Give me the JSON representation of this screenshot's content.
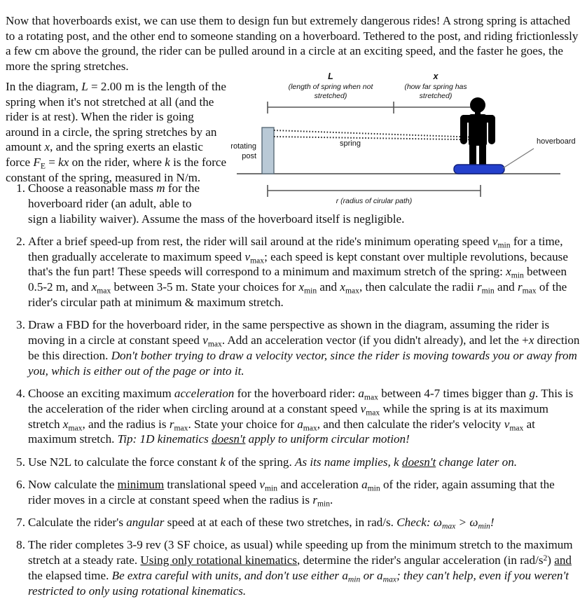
{
  "document": {
    "intro_paragraph": "Now that hoverboards exist, we can use them to design fun but extremely dangerous rides! A strong spring is attached to a rotating post, and the other end to someone standing on a hoverboard. Tethered to the post, and riding frictionlessly a few cm above the ground, the rider can be pulled around in a circle at an exciting speed, and the faster he goes, the more the spring stretches.",
    "setup_paragraph": {
      "segments": [
        "In the diagram, ",
        "L",
        " = 2.00 m is the length of the spring when it's not stretched at all (and the rider is at rest). When the rider is going around in a circle, the spring stretches by an amount ",
        "x",
        ", and the spring exerts an elastic force ",
        "F",
        "E",
        " = ",
        "kx",
        " on the rider, where ",
        "k",
        " is the force constant of the spring, measured in N/m."
      ],
      "spring_rest_length": "2.00 m",
      "spring_length_symbol": "L",
      "stretch_symbol": "x",
      "force_law": "F_E = kx",
      "force_constant_symbol": "k",
      "force_constant_units": "N/m"
    }
  },
  "figure": {
    "caption_L_symbol": "L",
    "caption_L_desc_line1": "(length of spring when not",
    "caption_L_desc_line2": "stretched)",
    "caption_x_symbol": "x",
    "caption_x_desc_line1": "(how far spring has",
    "caption_x_desc_line2": "stretched)",
    "label_rotating_post_line1": "rotating",
    "label_rotating_post_line2": "post",
    "label_spring": "spring",
    "label_hoverboard": "hoverboard",
    "label_radius": "r (radius of cirular path)",
    "colors": {
      "post_fill": "#b9c9d6",
      "post_stroke": "#5a6b78",
      "hoverboard_fill": "#2440cc",
      "hoverboard_stroke": "#101f7a",
      "rider_fill": "#000000",
      "dimension_line": "#555555",
      "ground_line": "#444444",
      "leader_line": "#777777",
      "spring_dots": "#222222"
    }
  },
  "questions": [
    {
      "number": "1.",
      "html": "Choose a reasonable mass <i>m</i> for the<br>hoverboard rider (an adult, able to<br>sign a liability waiver). Assume the mass of the hoverboard itself is negligible."
    },
    {
      "number": "2.",
      "html": "After a brief speed-up from rest, the rider will sail around at the ride's minimum operating speed <i>v</i><sub>min</sub> for a time, then gradually accelerate to maximum speed <i>v</i><sub>max</sub>; each speed is kept constant over multiple revolutions, because that's the fun part! These speeds will correspond to a minimum and maximum stretch of the spring: <i>x</i><sub>min</sub> between 0.5-2 m, and <i>x</i><sub>max</sub> between 3-5 m. State your choices for <i>x</i><sub>min</sub> and <i>x</i><sub>max</sub>, then calculate the radii <i>r</i><sub>min</sub> and <i>r</i><sub>max</sub> of the rider's circular path at minimum &amp; maximum stretch."
    },
    {
      "number": "3.",
      "html": "Draw a FBD for the hoverboard rider, in the same perspective as shown in the diagram, assuming the rider is moving in a circle at constant speed <i>v</i><sub>max</sub>. Add an acceleration vector (if you didn't already), and let the +<i>x</i> direction be this direction. <i>Don't bother trying to draw a velocity vector, since the rider is moving towards you or away from you, which is either out of the page or into it.</i>"
    },
    {
      "number": "4.",
      "html": "Choose an exciting maximum <i>acceleration</i> for the hoverboard rider: <i>a</i><sub>max</sub> between 4-7 times bigger than <i>g</i>. This is the acceleration of the rider when circling around at a constant speed <i>v</i><sub>max</sub> while the spring is at its maximum stretch <i>x</i><sub>max</sub>, and the radius is <i>r</i><sub>max</sub>. State your choice for <i>a</i><sub>max</sub>, and then calculate the rider's velocity <i>v</i><sub>max</sub> at maximum stretch. <i>Tip: 1D kinematics <span class=\"u\">doesn't</span> apply to uniform circular motion!</i>"
    },
    {
      "number": "5.",
      "html": "Use N2L to calculate the force constant <i>k</i> of the spring. <i>As its name implies, k <span class=\"u\">doesn't</span> change later on.</i>"
    },
    {
      "number": "6.",
      "html": "Now calculate the <span class=\"u\">minimum</span> translational speed <i>v</i><sub>min</sub> and acceleration <i>a</i><sub>min</sub> of the rider, again assuming that the rider moves in a circle at constant speed when the radius is <i>r</i><sub>min</sub>."
    },
    {
      "number": "7.",
      "html": "Calculate the rider's <i>angular</i> speed at at each of these two stretches, in rad/s. <i>Check: &omega;<sub>max</sub> &gt; &omega;<sub>min</sub>!</i>"
    },
    {
      "number": "8.",
      "html": "The rider completes 3-9 rev (3 SF choice, as usual) while speeding up from the minimum stretch to the maximum stretch at a steady rate. <span class=\"u\">Using only rotational kinematics</span>, determine the rider's angular acceleration (in rad/s<sup>2</sup>) <span class=\"u\">and</span> the elapsed time. <i>Be extra careful with units, and don't use either a<sub>min</sub> or a<sub>max</sub>; they can't help, even if you weren't restricted to only using rotational kinematics.</i>"
    }
  ]
}
